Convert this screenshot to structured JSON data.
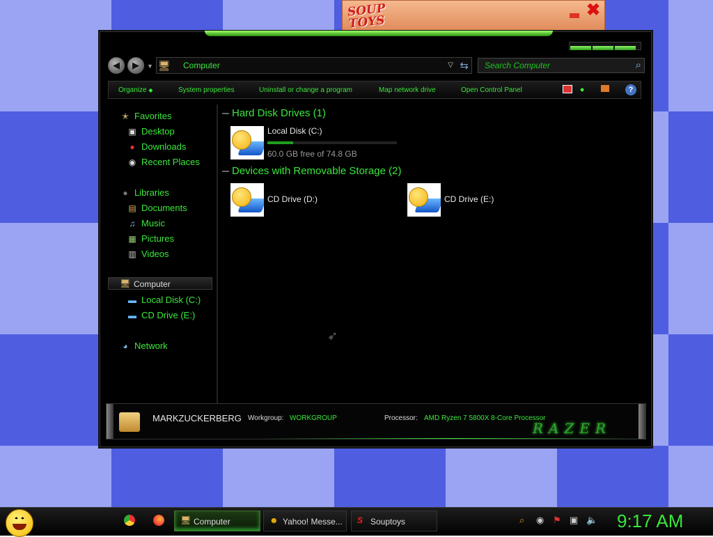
{
  "widget": {
    "logo_line1": "SOUP",
    "logo_line2": "TOYS"
  },
  "window": {
    "address": "Computer",
    "search_placeholder": "Search Computer",
    "toolbar": {
      "organize": "Organize",
      "system_properties": "System properties",
      "uninstall": "Uninstall or change a program",
      "map_drive": "Map network drive",
      "control_panel": "Open Control Panel",
      "help": "?"
    },
    "nav": {
      "favorites": "Favorites",
      "desktop": "Desktop",
      "downloads": "Downloads",
      "recent_places": "Recent Places",
      "libraries": "Libraries",
      "documents": "Documents",
      "music": "Music",
      "pictures": "Pictures",
      "videos": "Videos",
      "computer": "Computer",
      "local_disk": "Local Disk (C:)",
      "cd_drive_e": "CD Drive (E:)",
      "network": "Network"
    },
    "content": {
      "hdd_group": "Hard Disk Drives (1)",
      "local_disk": {
        "name": "Local Disk (C:)",
        "free": "60.0 GB free of 74.8 GB",
        "used_fraction": 0.198
      },
      "removable_group": "Devices with Removable Storage (2)",
      "cd_d": "CD Drive (D:)",
      "cd_e": "CD Drive (E:)"
    },
    "details": {
      "computer_name": "MARKZUCKERBERG",
      "workgroup_label": "Workgroup:",
      "workgroup_value": "WORKGROUP",
      "processor_label": "Processor:",
      "processor_value": "AMD Ryzen 7 5800X 8-Core Processor",
      "brand": "RAZER"
    }
  },
  "taskbar": {
    "tasks": [
      "Computer",
      "Yahoo! Messe...",
      "Souptoys"
    ],
    "clock": "9:17 AM"
  },
  "colors": {
    "accent": "#3be83b",
    "background": "#000000",
    "desktop_light": "#9aa4f2",
    "desktop_dark": "#4f5ee0"
  }
}
